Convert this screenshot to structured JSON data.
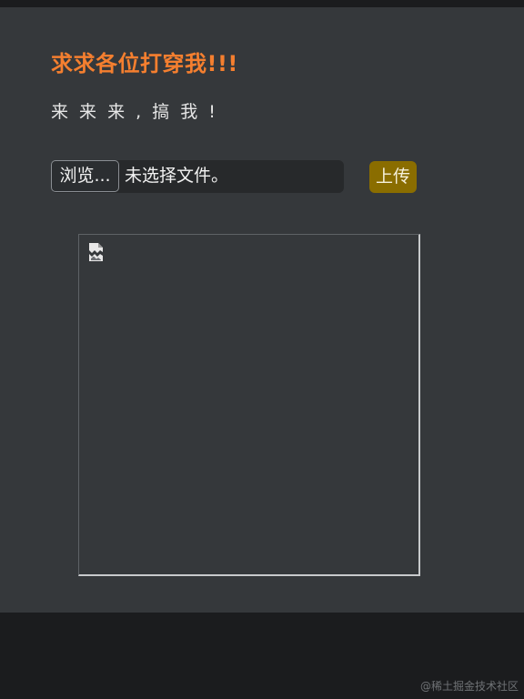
{
  "page": {
    "title": "求求各位打穿我!!!",
    "subtitle": "来 来 来 , 搞 我 !"
  },
  "upload_form": {
    "browse_label": "浏览...",
    "file_status": "未选择文件。",
    "upload_label": "上传"
  },
  "preview": {
    "icon": "broken-image-icon"
  },
  "footer": {
    "watermark": "@稀土掘金技术社区"
  },
  "colors": {
    "title": "#f57f2f",
    "panel_background": "#35383b",
    "page_background": "#1b1c1e",
    "upload_button": "#8a6d00"
  }
}
